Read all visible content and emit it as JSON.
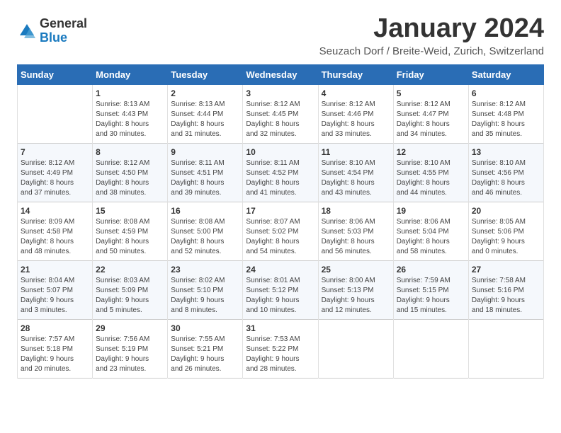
{
  "logo": {
    "general": "General",
    "blue": "Blue"
  },
  "title": "January 2024",
  "subtitle": "Seuzach Dorf / Breite-Weid, Zurich, Switzerland",
  "days": [
    "Sunday",
    "Monday",
    "Tuesday",
    "Wednesday",
    "Thursday",
    "Friday",
    "Saturday"
  ],
  "weeks": [
    [
      {
        "num": "",
        "content": ""
      },
      {
        "num": "1",
        "content": "Sunrise: 8:13 AM\nSunset: 4:43 PM\nDaylight: 8 hours\nand 30 minutes."
      },
      {
        "num": "2",
        "content": "Sunrise: 8:13 AM\nSunset: 4:44 PM\nDaylight: 8 hours\nand 31 minutes."
      },
      {
        "num": "3",
        "content": "Sunrise: 8:12 AM\nSunset: 4:45 PM\nDaylight: 8 hours\nand 32 minutes."
      },
      {
        "num": "4",
        "content": "Sunrise: 8:12 AM\nSunset: 4:46 PM\nDaylight: 8 hours\nand 33 minutes."
      },
      {
        "num": "5",
        "content": "Sunrise: 8:12 AM\nSunset: 4:47 PM\nDaylight: 8 hours\nand 34 minutes."
      },
      {
        "num": "6",
        "content": "Sunrise: 8:12 AM\nSunset: 4:48 PM\nDaylight: 8 hours\nand 35 minutes."
      }
    ],
    [
      {
        "num": "7",
        "content": "Sunrise: 8:12 AM\nSunset: 4:49 PM\nDaylight: 8 hours\nand 37 minutes."
      },
      {
        "num": "8",
        "content": "Sunrise: 8:12 AM\nSunset: 4:50 PM\nDaylight: 8 hours\nand 38 minutes."
      },
      {
        "num": "9",
        "content": "Sunrise: 8:11 AM\nSunset: 4:51 PM\nDaylight: 8 hours\nand 39 minutes."
      },
      {
        "num": "10",
        "content": "Sunrise: 8:11 AM\nSunset: 4:52 PM\nDaylight: 8 hours\nand 41 minutes."
      },
      {
        "num": "11",
        "content": "Sunrise: 8:10 AM\nSunset: 4:54 PM\nDaylight: 8 hours\nand 43 minutes."
      },
      {
        "num": "12",
        "content": "Sunrise: 8:10 AM\nSunset: 4:55 PM\nDaylight: 8 hours\nand 44 minutes."
      },
      {
        "num": "13",
        "content": "Sunrise: 8:10 AM\nSunset: 4:56 PM\nDaylight: 8 hours\nand 46 minutes."
      }
    ],
    [
      {
        "num": "14",
        "content": "Sunrise: 8:09 AM\nSunset: 4:58 PM\nDaylight: 8 hours\nand 48 minutes."
      },
      {
        "num": "15",
        "content": "Sunrise: 8:08 AM\nSunset: 4:59 PM\nDaylight: 8 hours\nand 50 minutes."
      },
      {
        "num": "16",
        "content": "Sunrise: 8:08 AM\nSunset: 5:00 PM\nDaylight: 8 hours\nand 52 minutes."
      },
      {
        "num": "17",
        "content": "Sunrise: 8:07 AM\nSunset: 5:02 PM\nDaylight: 8 hours\nand 54 minutes."
      },
      {
        "num": "18",
        "content": "Sunrise: 8:06 AM\nSunset: 5:03 PM\nDaylight: 8 hours\nand 56 minutes."
      },
      {
        "num": "19",
        "content": "Sunrise: 8:06 AM\nSunset: 5:04 PM\nDaylight: 8 hours\nand 58 minutes."
      },
      {
        "num": "20",
        "content": "Sunrise: 8:05 AM\nSunset: 5:06 PM\nDaylight: 9 hours\nand 0 minutes."
      }
    ],
    [
      {
        "num": "21",
        "content": "Sunrise: 8:04 AM\nSunset: 5:07 PM\nDaylight: 9 hours\nand 3 minutes."
      },
      {
        "num": "22",
        "content": "Sunrise: 8:03 AM\nSunset: 5:09 PM\nDaylight: 9 hours\nand 5 minutes."
      },
      {
        "num": "23",
        "content": "Sunrise: 8:02 AM\nSunset: 5:10 PM\nDaylight: 9 hours\nand 8 minutes."
      },
      {
        "num": "24",
        "content": "Sunrise: 8:01 AM\nSunset: 5:12 PM\nDaylight: 9 hours\nand 10 minutes."
      },
      {
        "num": "25",
        "content": "Sunrise: 8:00 AM\nSunset: 5:13 PM\nDaylight: 9 hours\nand 12 minutes."
      },
      {
        "num": "26",
        "content": "Sunrise: 7:59 AM\nSunset: 5:15 PM\nDaylight: 9 hours\nand 15 minutes."
      },
      {
        "num": "27",
        "content": "Sunrise: 7:58 AM\nSunset: 5:16 PM\nDaylight: 9 hours\nand 18 minutes."
      }
    ],
    [
      {
        "num": "28",
        "content": "Sunrise: 7:57 AM\nSunset: 5:18 PM\nDaylight: 9 hours\nand 20 minutes."
      },
      {
        "num": "29",
        "content": "Sunrise: 7:56 AM\nSunset: 5:19 PM\nDaylight: 9 hours\nand 23 minutes."
      },
      {
        "num": "30",
        "content": "Sunrise: 7:55 AM\nSunset: 5:21 PM\nDaylight: 9 hours\nand 26 minutes."
      },
      {
        "num": "31",
        "content": "Sunrise: 7:53 AM\nSunset: 5:22 PM\nDaylight: 9 hours\nand 28 minutes."
      },
      {
        "num": "",
        "content": ""
      },
      {
        "num": "",
        "content": ""
      },
      {
        "num": "",
        "content": ""
      }
    ]
  ]
}
